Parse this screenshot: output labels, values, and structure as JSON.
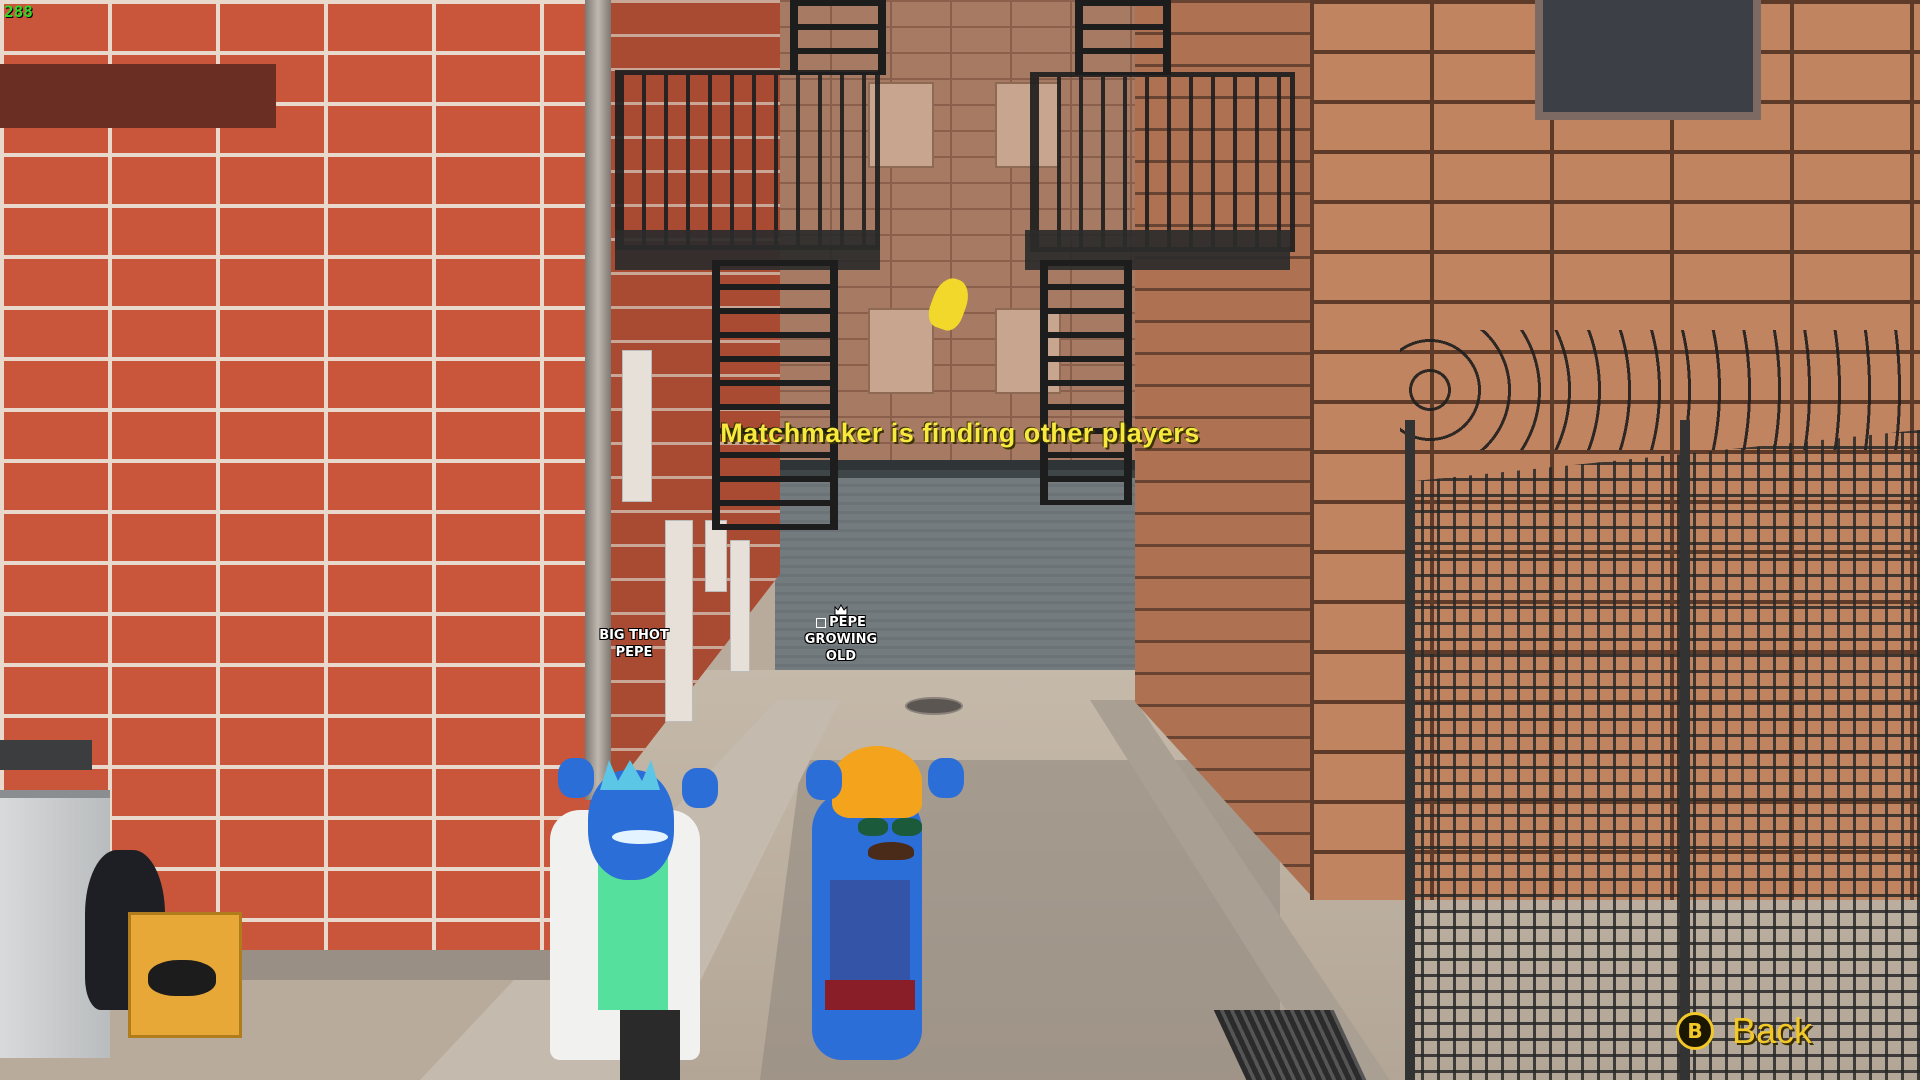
{
  "hud": {
    "fps": "288",
    "status_message": "Matchmaker is finding other players"
  },
  "players": [
    {
      "label_line1": "BIG THOT",
      "label_line2": "PEPE",
      "is_leader": false
    },
    {
      "label_line1": "PEPE",
      "label_line2": "GROWING",
      "label_line3": "OLD",
      "is_leader": true
    }
  ],
  "controls": {
    "back_button_glyph": "B",
    "back_label": "Back"
  },
  "colors": {
    "status_text": "#f7e93e",
    "back_text": "#f2c828",
    "fps_text": "#31d92b"
  },
  "icons": {
    "leader": "crown-icon",
    "back_glyph": "b-button-icon",
    "player_status": "checkbox-icon"
  }
}
